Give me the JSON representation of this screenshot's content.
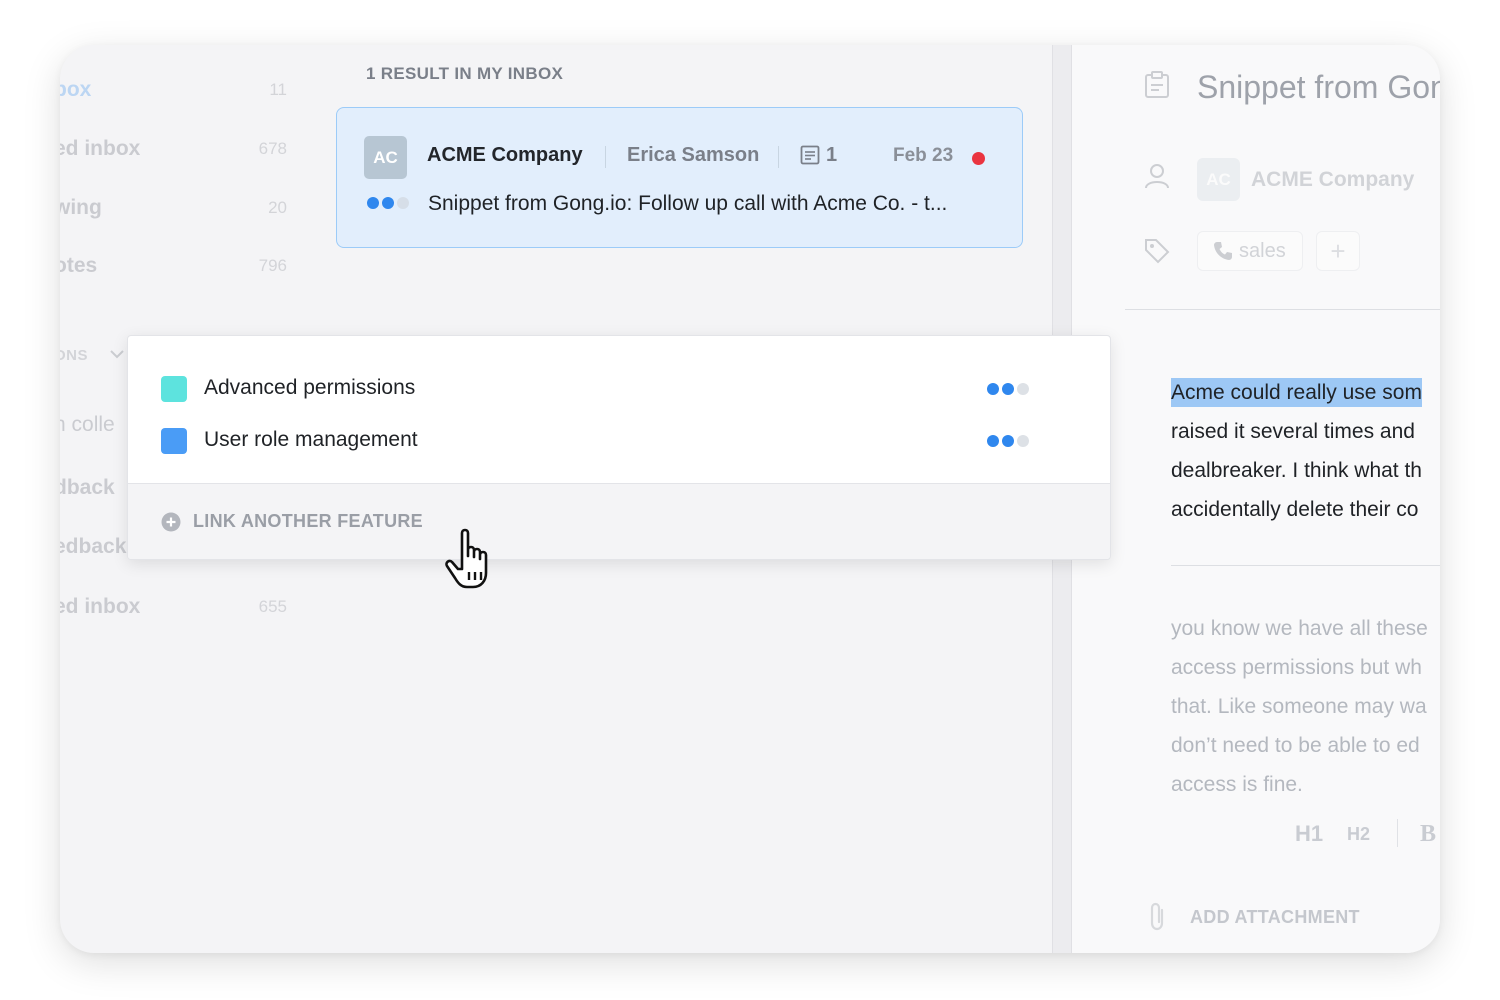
{
  "sidebar": {
    "items": [
      {
        "label": "box",
        "count": "11"
      },
      {
        "label": "ed inbox",
        "count": "678"
      },
      {
        "label": "wing",
        "count": "20"
      },
      {
        "label": "otes",
        "count": "796"
      },
      {
        "label": "h colle",
        "count": ""
      },
      {
        "label": "dback",
        "count": ""
      },
      {
        "label": "edback",
        "count": ""
      },
      {
        "label": "ed inbox",
        "count": "655"
      }
    ],
    "section_label": "ONS"
  },
  "results": {
    "header": "1 RESULT IN MY INBOX",
    "card": {
      "avatar_initials": "AC",
      "company": "ACME Company",
      "person": "Erica Samson",
      "note_count": "1",
      "date": "Feb 23",
      "snippet": "Snippet from Gong.io: Follow up call with Acme Co. - t...",
      "priority_level": 2,
      "unread_color": "#ea3440"
    }
  },
  "popover": {
    "features": [
      {
        "label": "Advanced permissions",
        "color": "#5de3de",
        "priority_level": 2
      },
      {
        "label": "User role management",
        "color": "#4a9cf6",
        "priority_level": 2
      }
    ],
    "footer_label": "LINK ANOTHER FEATURE"
  },
  "detail": {
    "title": "Snippet from Gon",
    "avatar_initials": "AC",
    "company": "ACME Company",
    "tag": "sales",
    "add_tag": "+",
    "note_lines": [
      "Acme could really use som",
      "raised it several times and",
      "dealbreaker. I think what th",
      "accidentally delete their co"
    ],
    "transcript_lines": [
      "you know we have all these",
      "access permissions but wh",
      "that. Like someone may wa",
      "don’t need to be able to ed",
      "access is fine."
    ],
    "format_buttons": [
      "H1",
      "H2",
      "B"
    ],
    "attach_label": "ADD ATTACHMENT"
  },
  "colors": {
    "accent": "#2f87ee",
    "card_bg": "#e2eefc",
    "card_border": "#9ccbf8",
    "highlight": "#9dc8f5"
  }
}
